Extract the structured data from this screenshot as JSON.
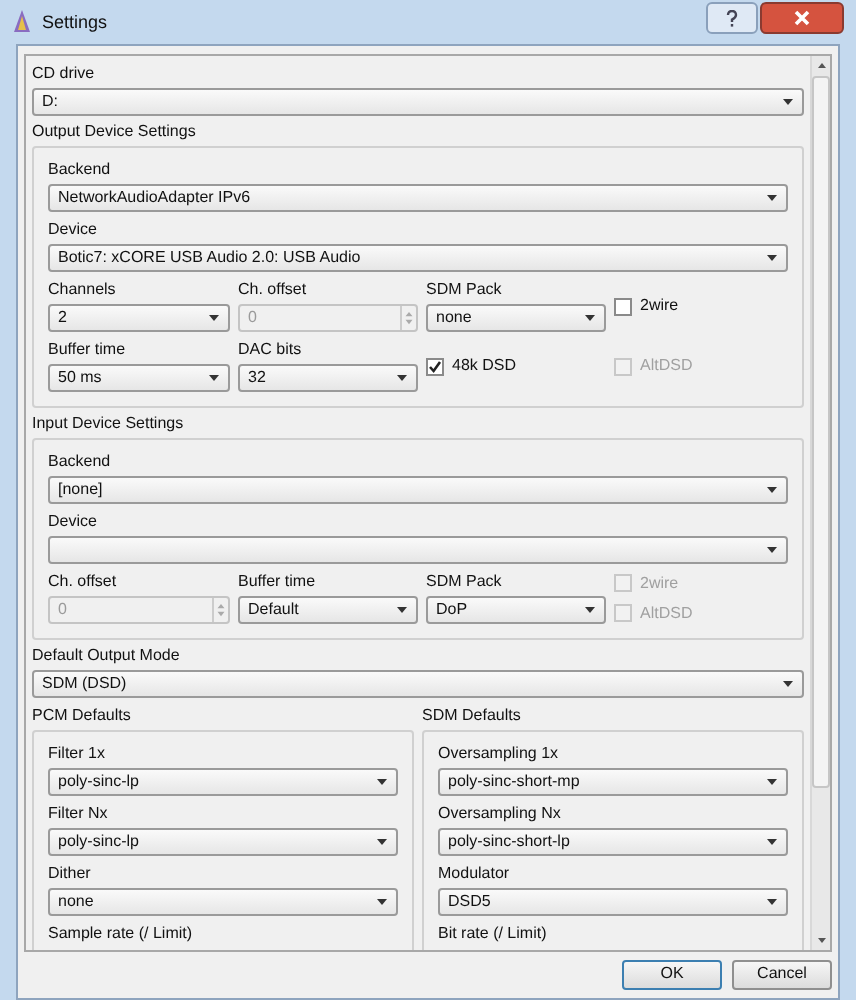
{
  "window": {
    "title": "Settings"
  },
  "cd_drive": {
    "label": "CD drive",
    "value": "D:"
  },
  "output_device": {
    "title": "Output Device Settings",
    "fields": [
      {
        "kind": "select",
        "label": "Backend",
        "value": "NetworkAudioAdapter IPv6"
      },
      {
        "kind": "select",
        "label": "Device",
        "value": "Botic7: xCORE USB Audio 2.0: USB Audio"
      },
      {
        "kind": "row",
        "items": [
          {
            "kind": "select",
            "label": "Channels",
            "value": "2"
          },
          {
            "kind": "spin",
            "label": "Ch. offset",
            "value": "0",
            "disabled": true
          },
          {
            "kind": "select",
            "label": "SDM Pack",
            "value": "none"
          },
          {
            "kind": "checks",
            "items": [
              {
                "label": "2wire",
                "checked": false,
                "disabled": false
              }
            ]
          }
        ]
      },
      {
        "kind": "row",
        "items": [
          {
            "kind": "select",
            "label": "Buffer time",
            "value": "50 ms"
          },
          {
            "kind": "select",
            "label": "DAC bits",
            "value": "32"
          },
          {
            "kind": "checks",
            "items": [
              {
                "label": "48k DSD",
                "checked": true,
                "disabled": false
              }
            ]
          },
          {
            "kind": "checks",
            "items": [
              {
                "label": "AltDSD",
                "checked": false,
                "disabled": true
              }
            ]
          }
        ]
      }
    ]
  },
  "input_device": {
    "title": "Input Device Settings",
    "fields": [
      {
        "kind": "select",
        "label": "Backend",
        "value": "[none]"
      },
      {
        "kind": "select",
        "label": "Device"
      },
      {
        "kind": "row",
        "items": [
          {
            "kind": "spin",
            "label": "Ch. offset",
            "value": "0",
            "disabled": true
          },
          {
            "kind": "select",
            "label": "Buffer time",
            "value": "Default"
          },
          {
            "kind": "select",
            "label": "SDM Pack",
            "value": "DoP"
          },
          {
            "kind": "checks",
            "items": [
              {
                "label": "2wire",
                "checked": false,
                "disabled": true
              },
              {
                "label": "AltDSD",
                "checked": false,
                "disabled": true
              }
            ]
          }
        ]
      }
    ]
  },
  "default_output_mode": {
    "label": "Default Output Mode",
    "value": "SDM (DSD)"
  },
  "pcm_defaults": {
    "title": "PCM Defaults",
    "fields": [
      {
        "kind": "select",
        "label": "Filter 1x",
        "value": "poly-sinc-lp"
      },
      {
        "kind": "select",
        "label": "Filter Nx",
        "value": "poly-sinc-lp"
      },
      {
        "kind": "select",
        "label": "Dither",
        "value": "none"
      },
      {
        "kind": "label",
        "label": "Sample rate (/ Limit)"
      }
    ]
  },
  "sdm_defaults": {
    "title": "SDM Defaults",
    "fields": [
      {
        "kind": "select",
        "label": "Oversampling 1x",
        "value": "poly-sinc-short-mp"
      },
      {
        "kind": "select",
        "label": "Oversampling Nx",
        "value": "poly-sinc-short-lp"
      },
      {
        "kind": "select",
        "label": "Modulator",
        "value": "DSD5"
      },
      {
        "kind": "label",
        "label": "Bit rate (/ Limit)"
      }
    ]
  },
  "buttons": [
    {
      "label": "OK"
    },
    {
      "label": "Cancel"
    }
  ]
}
